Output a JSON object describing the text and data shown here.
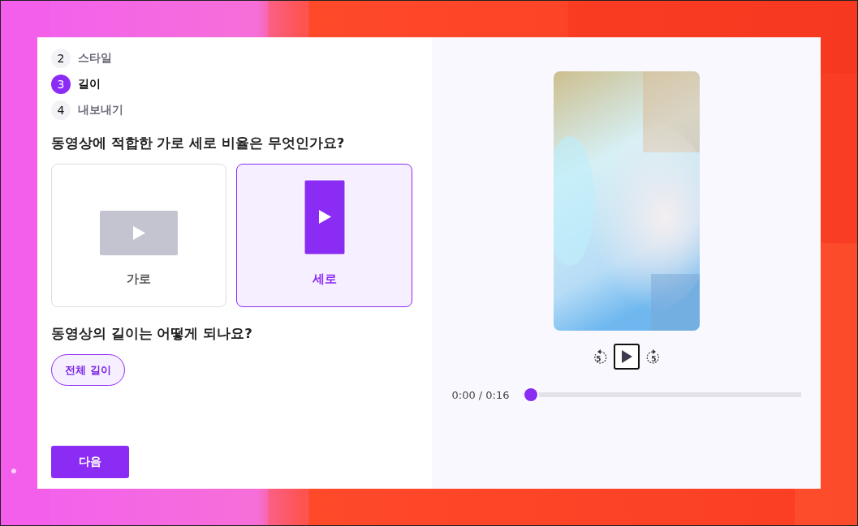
{
  "steps": [
    {
      "number": "2",
      "label": "스타일",
      "selected": false
    },
    {
      "number": "3",
      "label": "길이",
      "selected": true
    },
    {
      "number": "4",
      "label": "내보내기",
      "selected": false
    }
  ],
  "ratio_question": "동영상에 적합한 가로 세로 비율은 무엇인가요?",
  "ratio_options": [
    {
      "kind": "landscape",
      "label": "가로",
      "selected": false
    },
    {
      "kind": "portrait",
      "label": "세로",
      "selected": true
    }
  ],
  "length_question": "동영상의 길이는 어떻게 되나요?",
  "length_options": [
    {
      "label": "전체 길이",
      "selected": true
    }
  ],
  "next_button": "다음",
  "player": {
    "rewind": "5",
    "forward": "5",
    "time": "0:00 / 0:16",
    "level": 0.03
  }
}
